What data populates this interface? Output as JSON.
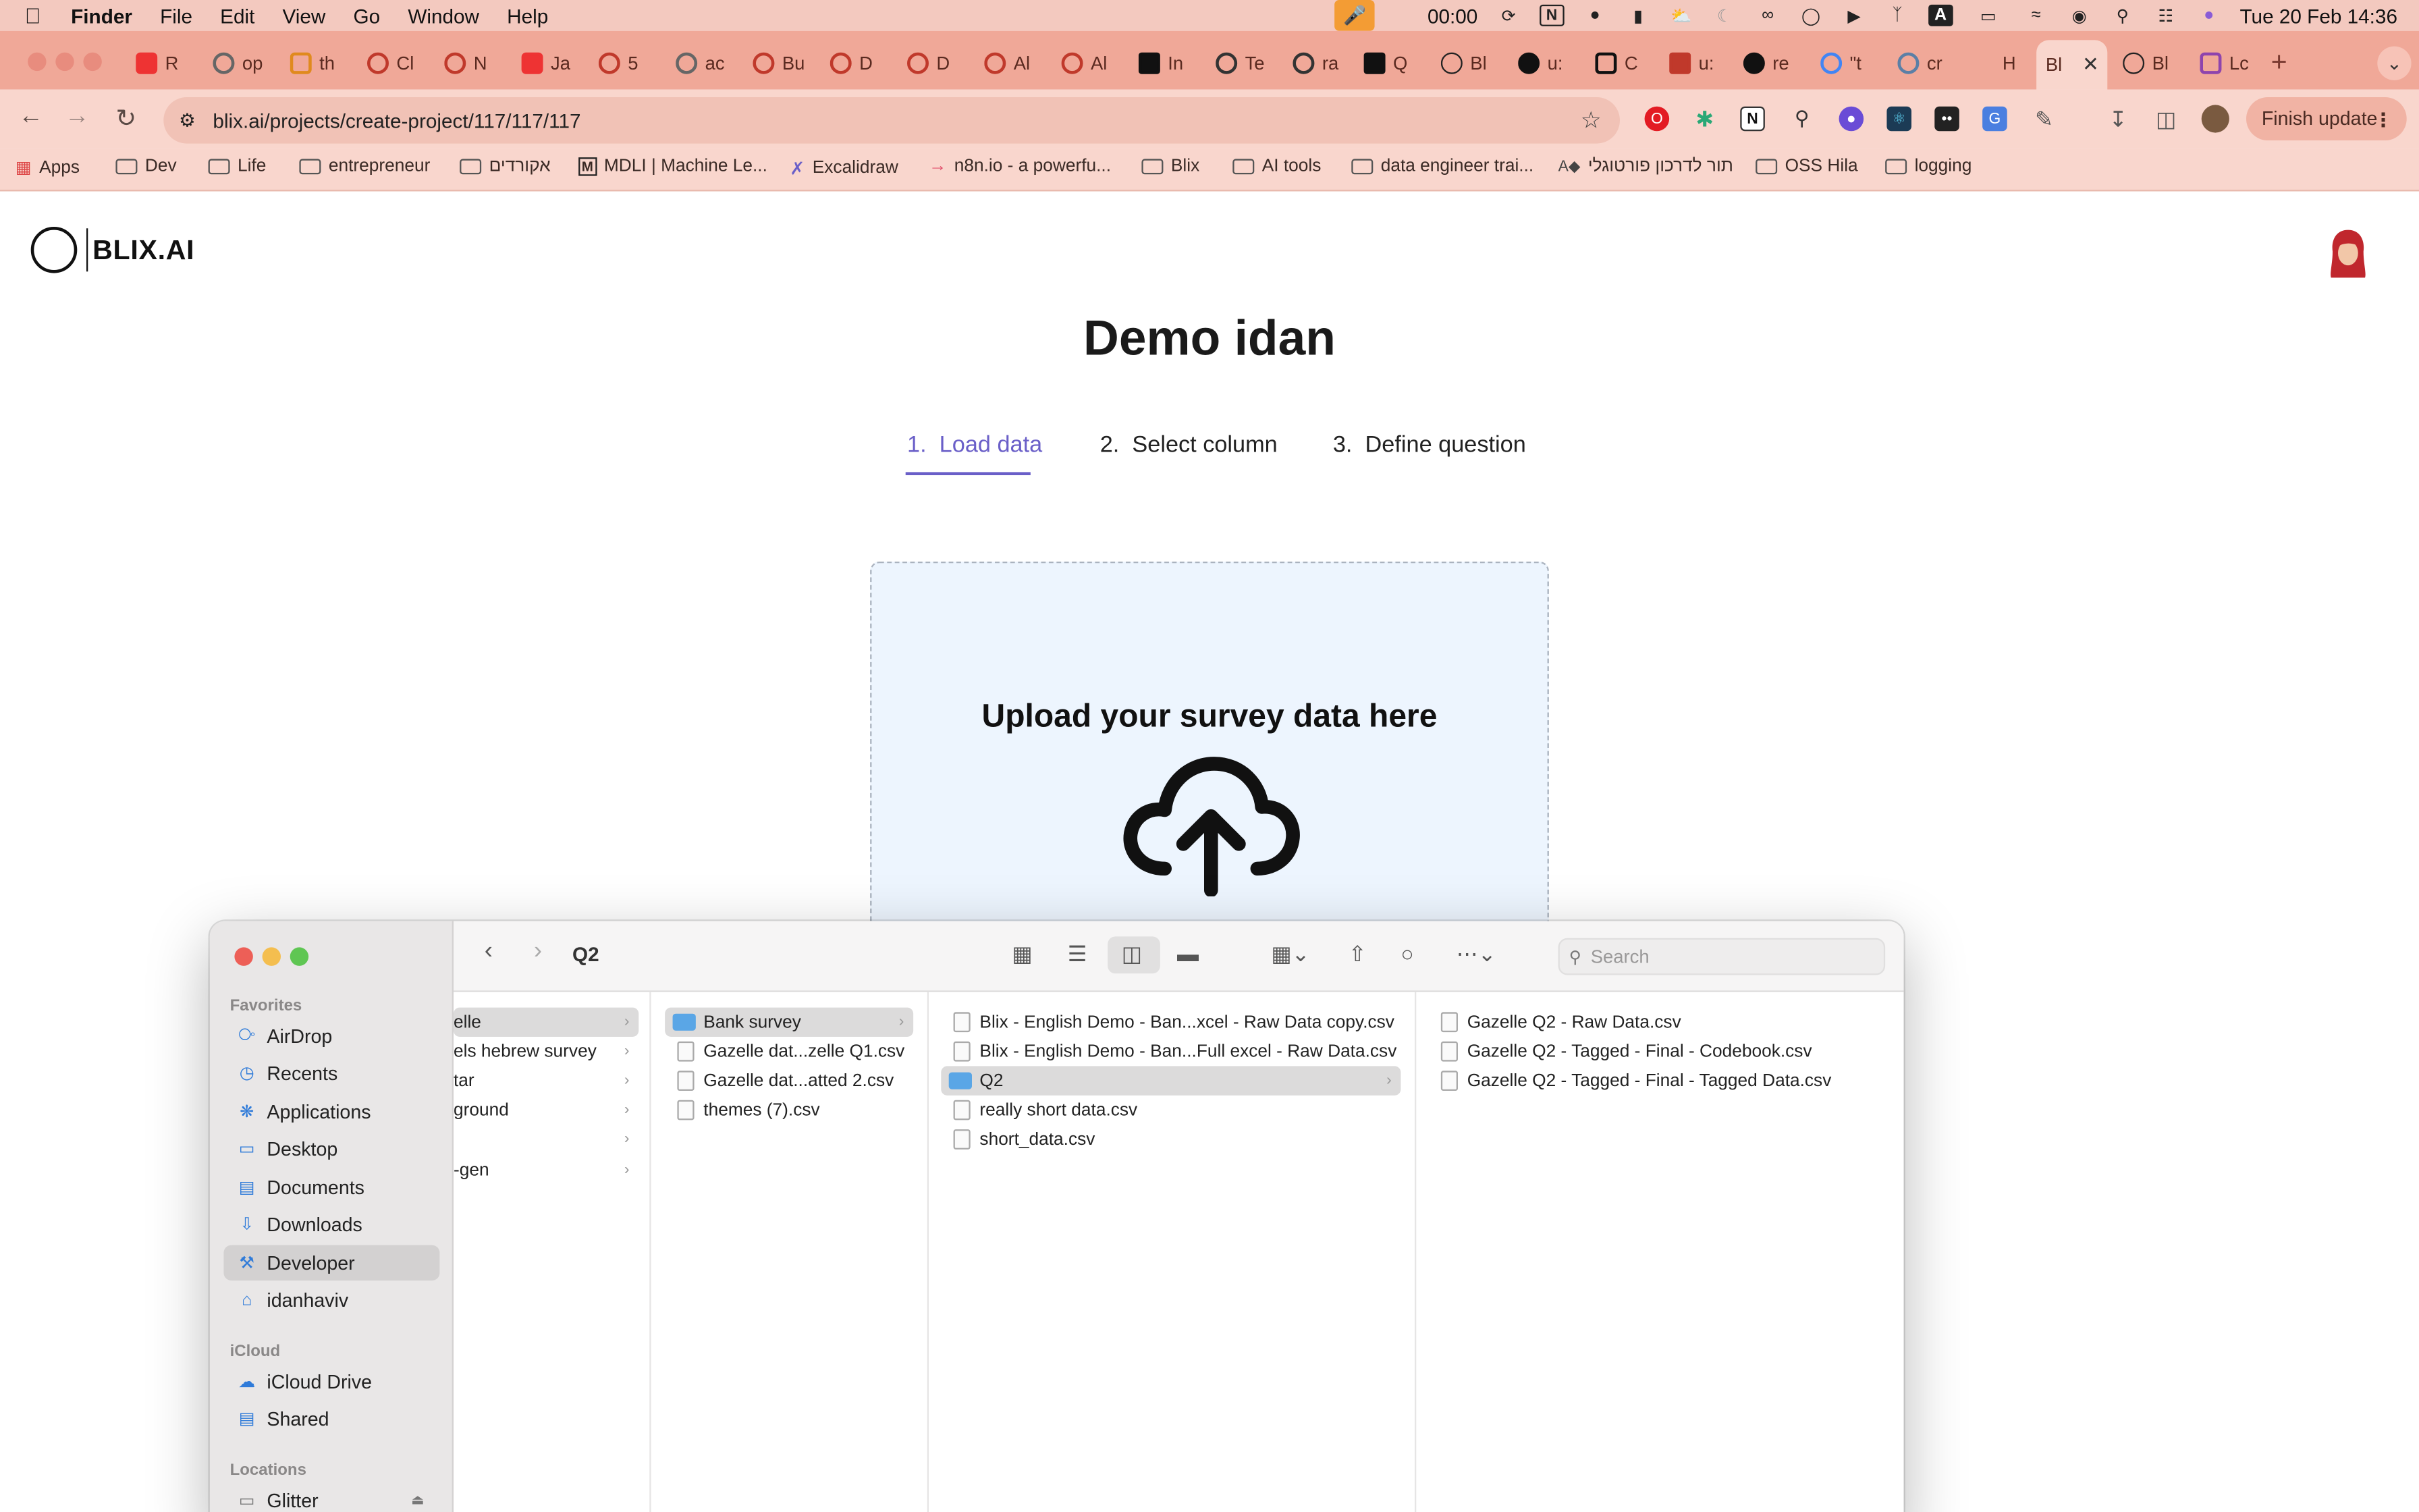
{
  "menubar": {
    "app": "Finder",
    "items": [
      "File",
      "Edit",
      "View",
      "Go",
      "Window",
      "Help"
    ],
    "timer": "00:00",
    "datetime": "Tue 20 Feb  14:36"
  },
  "browser": {
    "url": "blix.ai/projects/create-project/117/117/117",
    "finish_update": "Finish update",
    "tabs": [
      "R",
      "op",
      "th",
      "Cl",
      "N",
      "Ja",
      "5",
      "ac",
      "Bu",
      "D",
      "D",
      "Al",
      "Al",
      "In",
      "Te",
      "ra",
      "Q",
      "Bl",
      "u:",
      "C",
      "u:",
      "re",
      "\"t",
      "cr",
      "H",
      "Bl",
      "Bl",
      "Lc"
    ],
    "active_tab": "Bl",
    "bookmarks": [
      "Apps",
      "Dev",
      "Life",
      "entrepreneur",
      "אקורדים",
      "MDLI | Machine Le...",
      "Excalidraw",
      "n8n.io - a powerfu...",
      "Blix",
      "AI tools",
      "data engineer trai...",
      "תור לדרכון פורטוגלי",
      "OSS Hila",
      "logging"
    ]
  },
  "page": {
    "logo_text": "BLIX.AI",
    "title": "Demo idan",
    "steps": [
      {
        "num": "1.",
        "label": "Load data"
      },
      {
        "num": "2.",
        "label": "Select column"
      },
      {
        "num": "3.",
        "label": "Define question"
      }
    ],
    "upload_text": "Upload your survey data here"
  },
  "finder": {
    "folder_title": "Q2",
    "search_placeholder": "Search",
    "sidebar": {
      "favorites_label": "Favorites",
      "favorites": [
        "AirDrop",
        "Recents",
        "Applications",
        "Desktop",
        "Documents",
        "Downloads",
        "Developer",
        "idanhaviv"
      ],
      "icloud_label": "iCloud",
      "icloud": [
        "iCloud Drive",
        "Shared"
      ],
      "locations_label": "Locations",
      "locations": [
        "Glitter"
      ]
    },
    "col1": [
      "elle",
      "els hebrew survey",
      "tar",
      "ground",
      "",
      "-gen"
    ],
    "col2": [
      "Bank survey",
      "Gazelle dat...zelle Q1.csv",
      "Gazelle dat...atted 2.csv",
      "themes (7).csv"
    ],
    "col3": [
      "Blix - English Demo - Ban...xcel - Raw Data copy.csv",
      "Blix - English Demo - Ban...Full excel - Raw Data.csv",
      "Q2",
      "really short data.csv",
      "short_data.csv"
    ],
    "col4": [
      "Gazelle Q2 - Raw Data.csv",
      "Gazelle Q2 - Tagged - Final - Codebook.csv",
      "Gazelle Q2 - Tagged - Final - Tagged Data.csv"
    ]
  }
}
